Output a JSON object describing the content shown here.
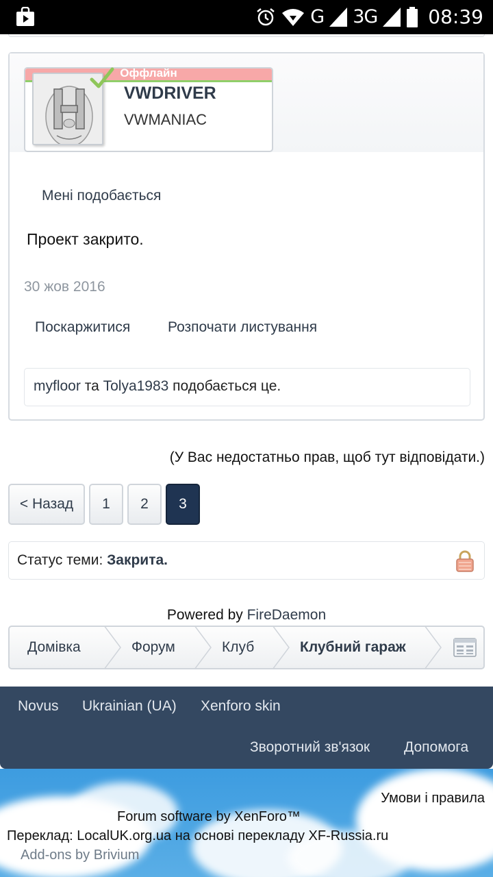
{
  "status_bar": {
    "network_type": "G",
    "network_type_2": "3G",
    "time": "08:39"
  },
  "post": {
    "status_banner": "Оффлайн",
    "username": "VWDRIVER",
    "user_title": "VWMANIAC",
    "like_label": "Мені подобається",
    "message": "Проект закрито.",
    "date": "30 жов 2016",
    "report_label": "Поскаржитися",
    "conversation_label": "Розпочати листування",
    "likes": {
      "user1": "myfloor",
      "sep": " та ",
      "user2": "Tolya1983",
      "suffix": " подобається це."
    }
  },
  "no_rights_text": "(У Вас недостатньо прав, щоб тут відповідати.)",
  "pagination": {
    "prev_label": "< Назад",
    "pages": [
      "1",
      "2",
      "3"
    ],
    "current": "3"
  },
  "thread_status": {
    "label": "Статус теми: ",
    "value": "Закрита."
  },
  "powered_by": {
    "prefix": "Powered by ",
    "name": "FireDaemon"
  },
  "breadcrumb": [
    "Домівка",
    "Форум",
    "Клуб",
    "Клубний гараж"
  ],
  "footer": {
    "links_top": [
      "Novus",
      "Ukrainian (UA)",
      "Xenforo skin"
    ],
    "links_bottom": [
      "Зворотний зв'язок",
      "Допомога"
    ],
    "terms": "Умови і правила",
    "software": "Forum software by XenForo™",
    "translation": "Переклад: LocalUK.org.ua на основі перекладу XF-Russia.ru",
    "addons": "Add-ons by Brivium"
  },
  "colors": {
    "dark_blue": "#1f3452",
    "footer_bg": "#344861",
    "offline_banner": "#f7a8a8",
    "link": "#2f3b4a"
  }
}
